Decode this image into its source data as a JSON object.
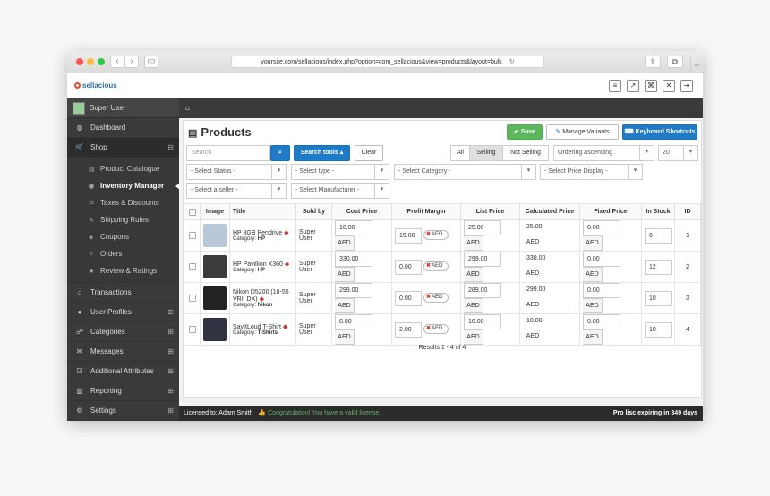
{
  "browser": {
    "url": "yoursite.com/sellacious/index.php?option=com_sellacious&view=products&layout=bulk"
  },
  "app": {
    "brand": "sellacious"
  },
  "sidebar": {
    "user": "Super User",
    "items": [
      {
        "label": "Dashboard",
        "icon": "dashboard-icon"
      },
      {
        "label": "Shop",
        "icon": "cart-icon"
      },
      {
        "label": "Transactions",
        "icon": "bank-icon"
      },
      {
        "label": "User Profiles",
        "icon": "user-icon"
      },
      {
        "label": "Categories",
        "icon": "sitemap-icon"
      },
      {
        "label": "Messages",
        "icon": "envelope-icon"
      },
      {
        "label": "Additional Attributes",
        "icon": "checkbox-icon"
      },
      {
        "label": "Reporting",
        "icon": "chart-icon"
      },
      {
        "label": "Settings",
        "icon": "gear-icon"
      }
    ],
    "shop_sub": [
      {
        "label": "Product Catalogue"
      },
      {
        "label": "Inventory Manager"
      },
      {
        "label": "Taxes & Discounts"
      },
      {
        "label": "Shipping Rules"
      },
      {
        "label": "Coupons"
      },
      {
        "label": "Orders"
      },
      {
        "label": "Review & Ratings"
      }
    ]
  },
  "page": {
    "title": "Products",
    "save": "Save",
    "manage_variants": "Manage Variants",
    "keyboard_shortcuts": "Keyboard Shortcuts"
  },
  "toolbar": {
    "search_placeholder": "Search",
    "search_tools": "Search tools ▴",
    "clear": "Clear",
    "seg_all": "All",
    "seg_selling": "Selling",
    "seg_not_selling": "Not Selling",
    "ordering": "Ordering ascending",
    "limit": "20"
  },
  "filters": {
    "status": "- Select Status -",
    "type": "- Select type -",
    "category": "- Select Category -",
    "price_display": "- Select Price Display -",
    "seller": "- Select a seller -",
    "manufacturer": "- Select Manufacturer -"
  },
  "table": {
    "headers": {
      "image": "Image",
      "title": "Title",
      "sold_by": "Sold by",
      "cost": "Cost Price",
      "margin": "Profit Margin",
      "list": "List Price",
      "calc": "Calculated Price",
      "fixed": "Fixed Price",
      "stock": "In Stock",
      "id": "ID"
    },
    "currency": "AED",
    "category_prefix": "Category:",
    "rows": [
      {
        "title": "HP 8GB Pendrive",
        "category": "HP",
        "sold_by": "Super User",
        "cost": "10.00",
        "margin": "15.00",
        "list": "25.00",
        "calc": "25.00",
        "fixed": "0.00",
        "stock": "6",
        "id": "1",
        "img_color": "#b7c9d8"
      },
      {
        "title": "HP Pavillion X360",
        "category": "HP",
        "sold_by": "Super User",
        "cost": "330.00",
        "margin": "0.00",
        "list": "299.00",
        "calc": "330.00",
        "fixed": "0.00",
        "stock": "12",
        "id": "2",
        "img_color": "#3b3b3b"
      },
      {
        "title": "Nikon D5200 (18-55 VRII DX)",
        "category": "Nikon",
        "sold_by": "Super User",
        "cost": "299.00",
        "margin": "0.00",
        "list": "289.00",
        "calc": "299.00",
        "fixed": "0.00",
        "stock": "10",
        "id": "3",
        "img_color": "#222222"
      },
      {
        "title": "SayItLoud T-Shirt",
        "category": "T-Shirts",
        "sold_by": "Super User",
        "cost": "8.00",
        "margin": "2.00",
        "list": "10.00",
        "calc": "10.00",
        "fixed": "0.00",
        "stock": "10",
        "id": "4",
        "img_color": "#2f3440"
      }
    ],
    "results": "Results 1 - 4 of 4"
  },
  "footer": {
    "licensed": "Licensed to: Adam Smith",
    "congrats": "Congratulation! You have a valid license.",
    "expiry": "Pro lisc expiring in 349 days"
  }
}
